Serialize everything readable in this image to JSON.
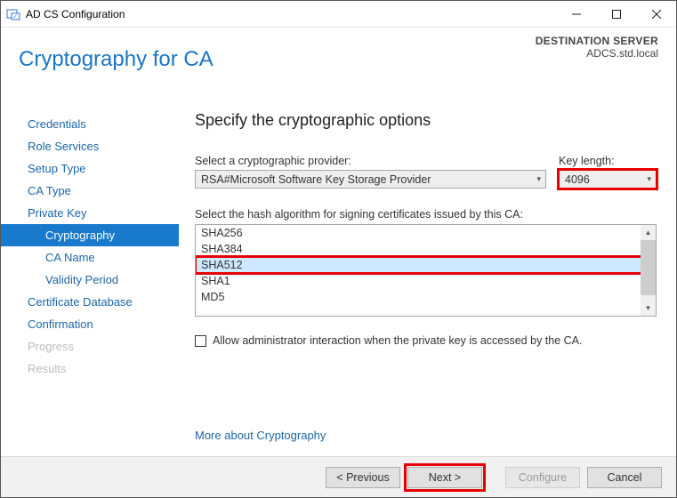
{
  "window": {
    "title": "AD CS Configuration",
    "destination_label": "DESTINATION SERVER",
    "destination_value": "ADCS.std.local"
  },
  "page": {
    "title": "Cryptography for CA",
    "heading": "Specify the cryptographic options"
  },
  "steps": {
    "credentials": "Credentials",
    "role_services": "Role Services",
    "setup_type": "Setup Type",
    "ca_type": "CA Type",
    "private_key": "Private Key",
    "cryptography": "Cryptography",
    "ca_name": "CA Name",
    "validity_period": "Validity Period",
    "certificate_database": "Certificate Database",
    "confirmation": "Confirmation",
    "progress": "Progress",
    "results": "Results"
  },
  "provider": {
    "label": "Select a cryptographic provider:",
    "value": "RSA#Microsoft Software Key Storage Provider"
  },
  "keylength": {
    "label": "Key length:",
    "value": "4096"
  },
  "hash": {
    "label": "Select the hash algorithm for signing certificates issued by this CA:",
    "items": {
      "sha256": "SHA256",
      "sha384": "SHA384",
      "sha512": "SHA512",
      "sha1": "SHA1",
      "md5": "MD5"
    },
    "selected": "SHA512"
  },
  "checkbox": {
    "label": "Allow administrator interaction when the private key is accessed by the CA."
  },
  "link": {
    "more": "More about Cryptography"
  },
  "buttons": {
    "previous": "< Previous",
    "next": "Next >",
    "configure": "Configure",
    "cancel": "Cancel"
  }
}
